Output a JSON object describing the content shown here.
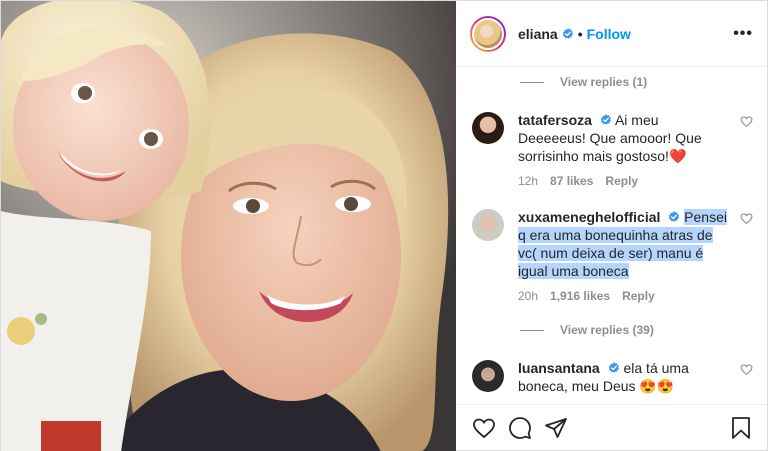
{
  "post": {
    "username": "eliana",
    "follow_label": "Follow",
    "dot": "•",
    "more_label": "•••"
  },
  "comments": [
    {
      "type": "replies",
      "label": "View replies (1)"
    },
    {
      "type": "comment",
      "username": "tatafersoza",
      "text": "Ai meu Deeeeeus! Que amooor! Que sorrisinho mais gostoso!❤️",
      "time": "12h",
      "likes": "87 likes",
      "reply": "Reply"
    },
    {
      "type": "comment",
      "username": "xuxameneghelofficial",
      "text": "Pensei q era uma bonequinha atras de vc( num deixa de ser) manu é igual uma boneca",
      "time": "20h",
      "likes": "1,916 likes",
      "reply": "Reply"
    },
    {
      "type": "replies",
      "label": "View replies (39)"
    },
    {
      "type": "comment",
      "username": "luansantana",
      "text": "ela tá uma boneca, meu Deus 😍😍"
    }
  ],
  "colors": {
    "link_blue": "#0095f6",
    "verified_blue": "#3897f0",
    "secondary_text": "#8e8e8e",
    "selection": "#b4d5fe",
    "like_red": "#ed4956"
  },
  "icons": [
    "verified-icon",
    "heart-icon",
    "comment-icon",
    "share-icon",
    "bookmark-icon",
    "more-icon"
  ]
}
